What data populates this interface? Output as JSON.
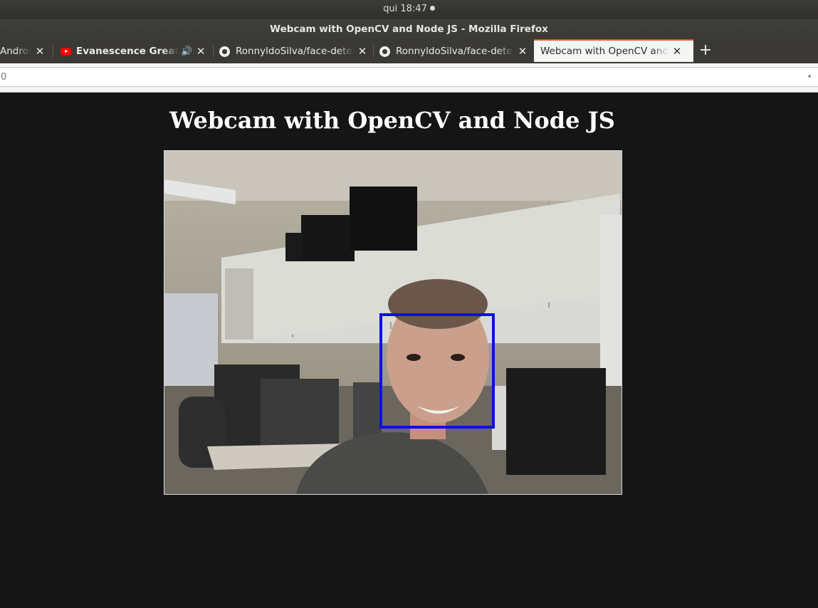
{
  "system_bar": {
    "clock": "qui 18:47"
  },
  "window": {
    "title": "Webcam with OpenCV and Node JS - Mozilla Firefox"
  },
  "tabs": [
    {
      "label": "Androi",
      "icon": "android-icon",
      "active": false
    },
    {
      "label": "Evanescence Greates",
      "icon": "youtube-icon",
      "audio": true,
      "active": false
    },
    {
      "label": "RonnyldoSilva/face-dete",
      "icon": "github-icon",
      "active": false
    },
    {
      "label": "RonnyldoSilva/face-dete",
      "icon": "github-icon",
      "active": false
    },
    {
      "label": "Webcam with OpenCV and N",
      "icon": "",
      "active": true
    }
  ],
  "new_tab_label": "+",
  "address_bar": {
    "value": "0",
    "trailing": "•"
  },
  "page": {
    "heading": "Webcam with OpenCV and Node JS",
    "video": {
      "face_detected": true,
      "box_color": "#1010e0"
    }
  },
  "colors": {
    "page_bg": "#151515",
    "accent": "#e95420"
  }
}
